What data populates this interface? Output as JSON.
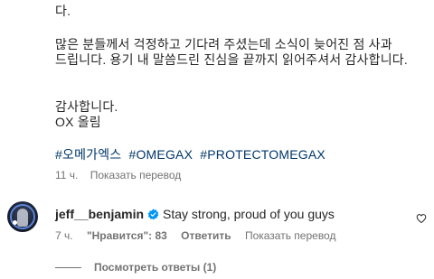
{
  "caption": {
    "line1": "다.",
    "line2": "많은 분들께서 걱정하고 기다려 주셨는데 소식이 늦어진 점 사과",
    "line3": "드립니다. 용기 내 말씀드린 진심을 끝까지 읽어주셔서 감사합니다.",
    "line4": "감사합니다.",
    "line5": "OX 올림",
    "hashtags": [
      "#오메가엑스",
      "#OMEGAX",
      "#PROTECTOMEGAX"
    ]
  },
  "post_meta": {
    "time": "11 ч.",
    "translate": "Показать перевод"
  },
  "comment": {
    "username": "jeff__benjamin",
    "text": "Stay strong, proud of you guys",
    "time": "7 ч.",
    "likes": "\"Нравится\": 83",
    "reply": "Ответить",
    "translate": "Показать перевод",
    "view_replies": "Посмотреть ответы (1)"
  },
  "colors": {
    "text": "#262626",
    "secondary": "#737373",
    "hashtag": "#00376b",
    "verified": "#0095f6"
  }
}
